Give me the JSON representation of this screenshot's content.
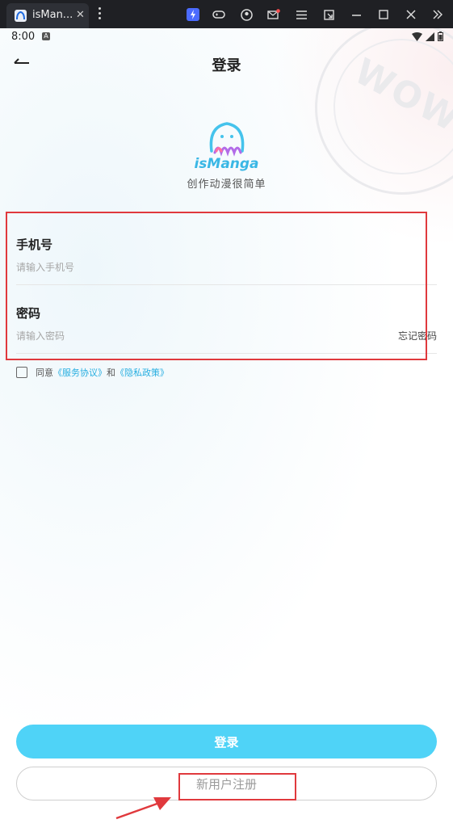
{
  "chrome": {
    "tab_title": "isMan...",
    "tab_close": "✕",
    "icons": [
      "emulator-logo-icon",
      "gamepad-icon",
      "account-icon",
      "mail-icon",
      "menu-icon",
      "popout-icon",
      "minimize-icon",
      "maximize-icon",
      "close-icon",
      "collapse-icon"
    ],
    "accent": "#4b6bff"
  },
  "status": {
    "time": "8:00",
    "badge": "A"
  },
  "header": {
    "title": "登录"
  },
  "brand": {
    "name": "isManga",
    "slogan": "创作动漫很简单",
    "watermark": "WOW!"
  },
  "form": {
    "phone_label": "手机号",
    "phone_placeholder": "请输入手机号",
    "password_label": "密码",
    "password_placeholder": "请输入密码",
    "forgot": "忘记密码"
  },
  "agreement": {
    "prefix": "同意",
    "terms": "《服务协议》",
    "and": "和",
    "privacy": "《隐私政策》"
  },
  "actions": {
    "login": "登录",
    "register": "新用户注册"
  },
  "colors": {
    "primary": "#4fd3f7",
    "link": "#27aee0",
    "annotation": "#e0393d"
  }
}
